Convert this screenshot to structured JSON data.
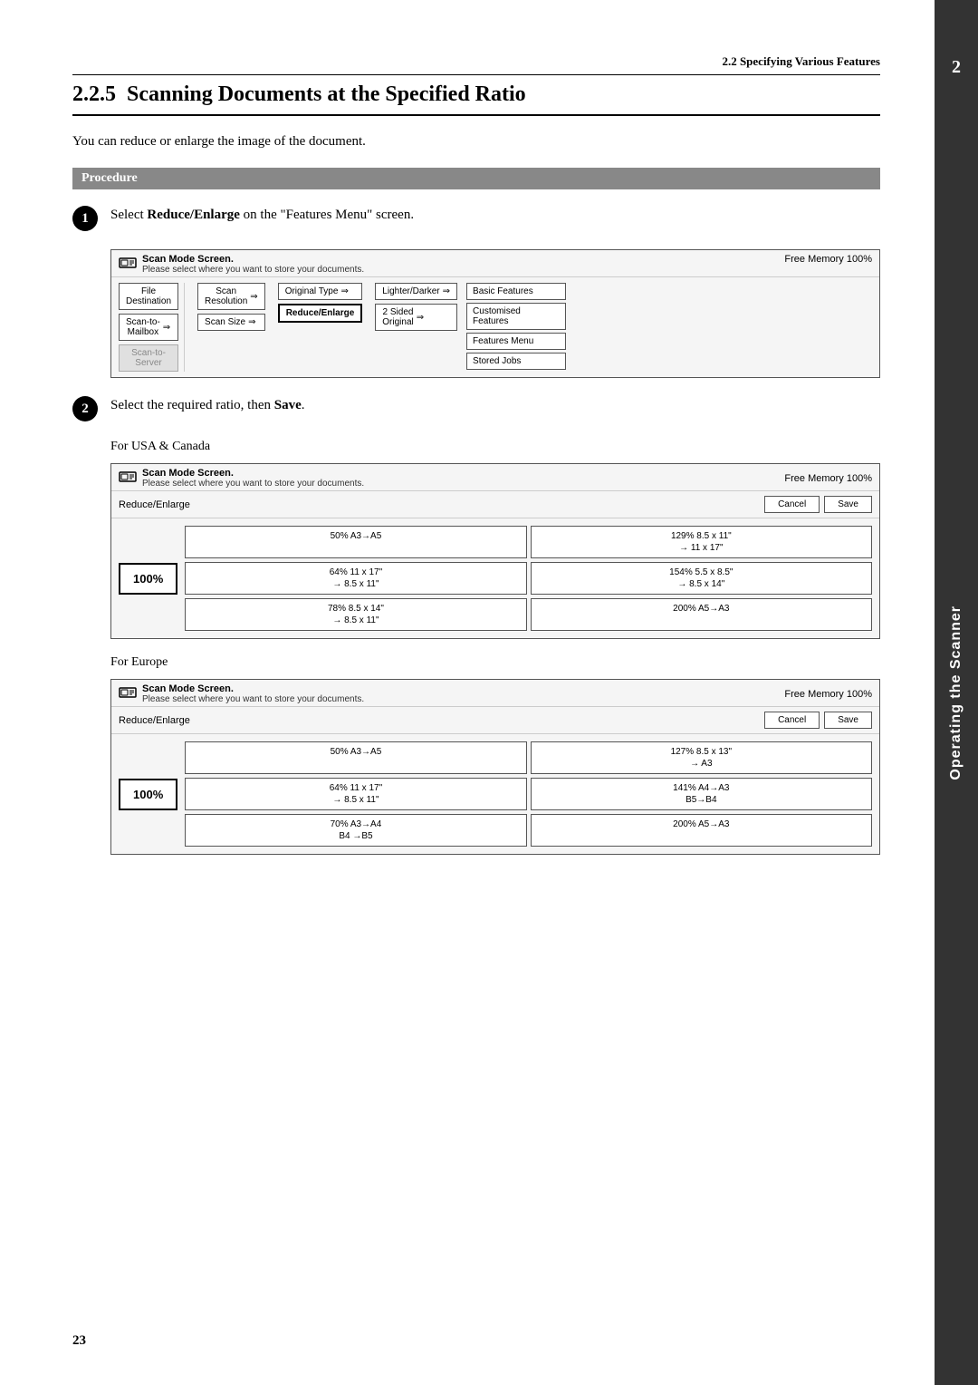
{
  "header": {
    "section": "2.2 Specifying Various Features"
  },
  "title": {
    "number": "2.2.5",
    "text": "Scanning Documents at the Specified Ratio"
  },
  "intro": "You can reduce or enlarge the image of the document.",
  "procedure_label": "Procedure",
  "steps": [
    {
      "number": "1",
      "text": "Select ",
      "bold": "Reduce/Enlarge",
      "text2": " on the \"Features Menu\" screen."
    },
    {
      "number": "2",
      "text": "Select the required ratio, then ",
      "bold": "Save",
      "text2": "."
    }
  ],
  "screen1": {
    "title": "Scan Mode Screen.",
    "subtitle": "Please select where you want to store your documents.",
    "memory": "Free Memory  100%",
    "left_items": [
      {
        "label": "File\nDestination"
      },
      {
        "label": "Scan-to-\nMailbox",
        "arrow": true
      },
      {
        "label": "Scan-to-\nServer",
        "disabled": true
      }
    ],
    "center_items": [
      {
        "label": "Scan\nResolution",
        "arrow": true
      },
      {
        "label": "Scan Size",
        "arrow": true
      }
    ],
    "feature_items": [
      {
        "label": "Original Type",
        "arrow": true
      },
      {
        "label": "Reduce/Enlarge",
        "highlight": true
      }
    ],
    "feature2_items": [
      {
        "label": "Lighter/Darker",
        "arrow": true
      },
      {
        "label": "2 Sided\nOriginal",
        "arrow": true
      }
    ],
    "right_items": [
      {
        "label": "Basic Features"
      },
      {
        "label": "Customised\nFeatures"
      },
      {
        "label": "Features Menu"
      },
      {
        "label": "Stored Jobs"
      }
    ]
  },
  "for_usa_canada": "For USA & Canada",
  "screen2": {
    "title": "Scan Mode Screen.",
    "subtitle": "Please select where you want to store your documents.",
    "memory": "Free Memory  100%",
    "toolbar_label": "Reduce/Enlarge",
    "cancel_btn": "Cancel",
    "save_btn": "Save",
    "current_value": "100%",
    "options": [
      {
        "line1": "50%  A3→A5",
        "line2": ""
      },
      {
        "line1": "129% 8.5 x 11\"",
        "line2": "→ 11 x 17\""
      },
      {
        "line1": "64%  11 x 17\"",
        "line2": "→ 8.5 x 11\""
      },
      {
        "line1": "154% 5.5 x 8.5\"",
        "line2": "→ 8.5 x 14\""
      },
      {
        "line1": "78% 8.5 x 14\"",
        "line2": "→ 8.5 x 11\""
      },
      {
        "line1": "200% A5→A3",
        "line2": ""
      }
    ]
  },
  "for_europe": "For Europe",
  "screen3": {
    "title": "Scan Mode Screen.",
    "subtitle": "Please select where you want to store your documents.",
    "memory": "Free Memory  100%",
    "toolbar_label": "Reduce/Enlarge",
    "cancel_btn": "Cancel",
    "save_btn": "Save",
    "current_value": "100%",
    "options": [
      {
        "line1": "50%  A3→A5",
        "line2": ""
      },
      {
        "line1": "127% 8.5 x 13\"",
        "line2": "→ A3"
      },
      {
        "line1": "64%  11 x 17\"",
        "line2": "→ 8.5 x 11\""
      },
      {
        "line1": "141% A4→A3",
        "line2": "B5→B4"
      },
      {
        "line1": "70%  A3→A4",
        "line2": "B4 →B5"
      },
      {
        "line1": "200% A5→A3",
        "line2": ""
      }
    ]
  },
  "side_tab": "Operating the Scanner",
  "side_number": "2",
  "page_number": "23"
}
